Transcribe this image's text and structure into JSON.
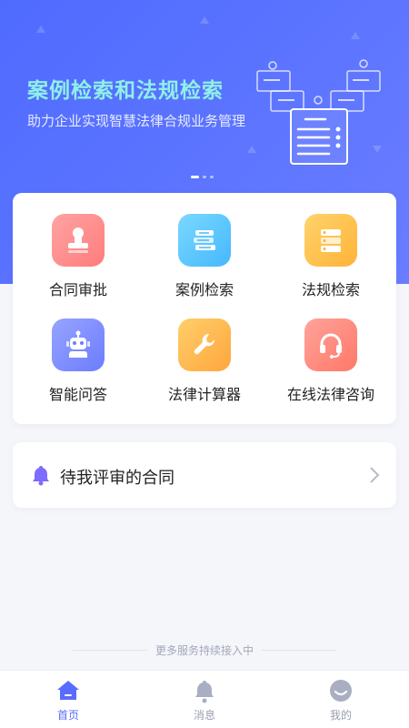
{
  "banner": {
    "title": "案例检索和法规检索",
    "subtitle": "助力企业实现智慧法律合规业务管理",
    "title_color": "#8ff0e8",
    "bg_color": "#5a73ff",
    "page_indicator": {
      "count": 3,
      "active_index": 0
    }
  },
  "services": [
    {
      "label": "合同审批",
      "icon": "stamp-icon",
      "color": "#ff8a8a"
    },
    {
      "label": "案例检索",
      "icon": "books-icon",
      "color": "#5cc8ff"
    },
    {
      "label": "法规检索",
      "icon": "server-list-icon",
      "color": "#ffc04d"
    },
    {
      "label": "智能问答",
      "icon": "robot-icon",
      "color": "#7d8cff"
    },
    {
      "label": "法律计算器",
      "icon": "wrench-icon",
      "color": "#ffb347"
    },
    {
      "label": "在线法律咨询",
      "icon": "headset-icon",
      "color": "#ff8a7a"
    }
  ],
  "pending": {
    "label": "待我评审的合同",
    "icon": "bell-icon",
    "accent": "#7e6bff"
  },
  "footer_note": "更多服务持续接入中",
  "tabbar": {
    "tabs": [
      {
        "label": "首页",
        "icon": "home-icon",
        "active": true
      },
      {
        "label": "消息",
        "icon": "bell-icon",
        "active": false
      },
      {
        "label": "我的",
        "icon": "smile-icon",
        "active": false
      }
    ],
    "active_color": "#5a6cff"
  }
}
